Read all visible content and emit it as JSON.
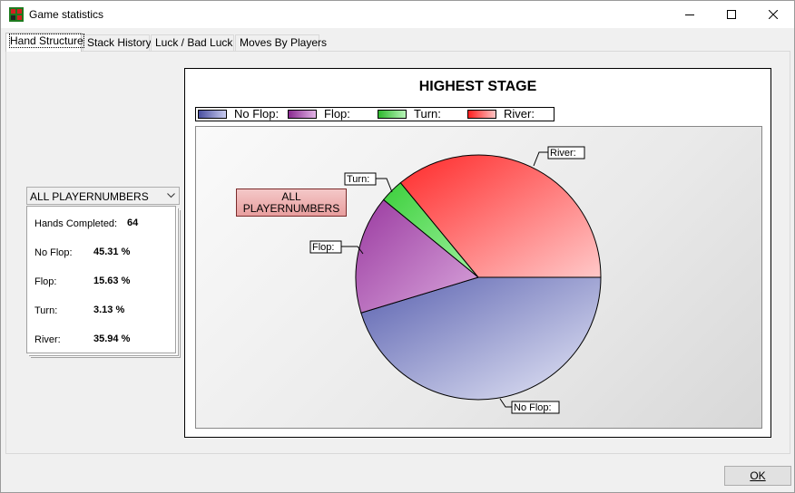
{
  "window": {
    "title": "Game statistics"
  },
  "tabs": [
    {
      "label": "Hand Structure",
      "active": true
    },
    {
      "label": "Stack History",
      "active": false
    },
    {
      "label": "Luck / Bad Luck",
      "active": false
    },
    {
      "label": "Moves By Players",
      "active": false
    }
  ],
  "filter": {
    "selected": "ALL PLAYERNUMBERS"
  },
  "stats": {
    "hands_completed_label": "Hands Completed:",
    "hands_completed_value": "64",
    "rows": [
      {
        "label": "No Flop:",
        "value": "45.31 %"
      },
      {
        "label": "Flop:",
        "value": "15.63 %"
      },
      {
        "label": "Turn:",
        "value": "3.13 %"
      },
      {
        "label": "River:",
        "value": "35.94 %"
      }
    ]
  },
  "chart_label": "ALL PLAYERNUMBERS",
  "chart_data": {
    "type": "pie",
    "title": "HIGHEST STAGE",
    "legend_position": "top-left",
    "categories": [
      "No Flop:",
      "Flop:",
      "Turn:",
      "River:"
    ],
    "values": [
      45.31,
      15.63,
      3.13,
      35.94
    ],
    "colors": [
      "#5b62b0",
      "#9a3aa0",
      "#3ccf3c",
      "#ff2a2a"
    ],
    "light_colors": [
      "#e6e8f7",
      "#d9a6dc",
      "#9df29d",
      "#ffc8c8"
    ]
  },
  "buttons": {
    "ok": "OK"
  }
}
